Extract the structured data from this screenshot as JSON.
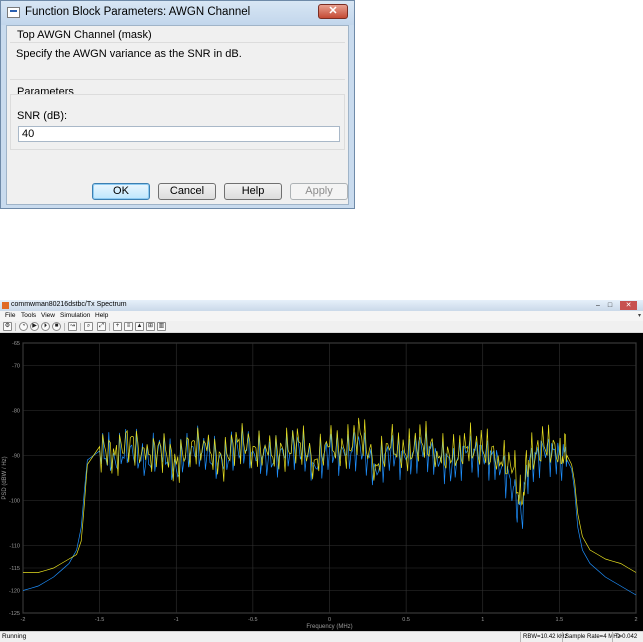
{
  "dialog": {
    "title": "Function Block Parameters: AWGN Channel",
    "close_label": "✕",
    "app_icon": "simulink-block-icon",
    "mask_header": "Top AWGN Channel (mask)",
    "description": "Specify the AWGN variance as the SNR in dB.",
    "params_header": "Parameters",
    "snr_label": "SNR (dB):",
    "snr_value": "40",
    "buttons": {
      "ok": "OK",
      "cancel": "Cancel",
      "help": "Help",
      "apply": "Apply"
    }
  },
  "scope": {
    "title": "commwman80216dstbc/Tx Spectrum",
    "app_icon": "matlab-icon",
    "window_buttons": {
      "minimize": "–",
      "maximize": "□",
      "close": "✕"
    },
    "menu": [
      "File",
      "Tools",
      "View",
      "Simulation",
      "Help"
    ],
    "menu_arrow": "▾",
    "toolbar_icons": [
      "scope-settings-icon",
      "run-icon",
      "play-icon",
      "step-icon",
      "stop-icon",
      "highlight-icon",
      "zoom-icon",
      "autoscale-icon",
      "data-cursor-icon",
      "measurements-icon",
      "peak-finder-icon",
      "cursor-measurements-icon",
      "channel-measurements-icon"
    ],
    "status": {
      "state": "Running",
      "rbw": "RBW=10.42 kHz",
      "sample_rate": "Sample Rate=4 MHz",
      "time": "T=0.042"
    }
  },
  "chart_data": {
    "type": "line",
    "title": "",
    "xlabel": "Frequency (MHz)",
    "ylabel": "PSD (dBW / Hz)",
    "xlim": [
      -2,
      2
    ],
    "ylim": [
      -125,
      -65
    ],
    "xticks": [
      "-2",
      "-1.5",
      "-1",
      "-0.5",
      "0",
      "0.5",
      "1",
      "1.5",
      "2"
    ],
    "yticks": [
      "-65",
      "-70",
      "-80",
      "-90",
      "-100",
      "-110",
      "-115",
      "-120",
      "-125"
    ],
    "grid": true,
    "background": "#000000",
    "series": [
      {
        "color": "#1e90ff",
        "x": [
          -2,
          -1.9,
          -1.8,
          -1.7,
          -1.65,
          -1.62,
          -1.6,
          -1.58,
          -1.5,
          -1.4,
          -1.3,
          -1.2,
          -1.1,
          -1.0,
          -0.9,
          -0.8,
          -0.7,
          -0.6,
          -0.5,
          -0.4,
          -0.3,
          -0.2,
          -0.1,
          0,
          0.1,
          0.2,
          0.3,
          0.4,
          0.5,
          0.6,
          0.7,
          0.8,
          0.9,
          1.0,
          1.1,
          1.2,
          1.25,
          1.3,
          1.4,
          1.5,
          1.55,
          1.58,
          1.6,
          1.62,
          1.65,
          1.7,
          1.8,
          1.9,
          2
        ],
        "values": [
          -120,
          -119,
          -117,
          -114,
          -111,
          -106,
          -98,
          -91,
          -89,
          -91,
          -88,
          -92,
          -89,
          -93,
          -88,
          -90,
          -92,
          -88,
          -89,
          -91,
          -90,
          -88,
          -92,
          -89,
          -90,
          -88,
          -93,
          -89,
          -91,
          -88,
          -90,
          -92,
          -89,
          -90,
          -91,
          -97,
          -103,
          -92,
          -89,
          -90,
          -91,
          -93,
          -98,
          -106,
          -111,
          -114,
          -117,
          -119,
          -121
        ]
      },
      {
        "color": "#e8e020",
        "x": [
          -2,
          -1.9,
          -1.8,
          -1.7,
          -1.65,
          -1.62,
          -1.6,
          -1.58,
          -1.5,
          -1.4,
          -1.3,
          -1.2,
          -1.1,
          -1.0,
          -0.9,
          -0.8,
          -0.7,
          -0.6,
          -0.5,
          -0.4,
          -0.3,
          -0.2,
          -0.1,
          0,
          0.1,
          0.2,
          0.3,
          0.4,
          0.5,
          0.6,
          0.7,
          0.8,
          0.9,
          1.0,
          1.1,
          1.2,
          1.25,
          1.3,
          1.4,
          1.5,
          1.55,
          1.58,
          1.6,
          1.62,
          1.65,
          1.7,
          1.8,
          1.9,
          2
        ],
        "values": [
          -116,
          -116,
          -115,
          -113,
          -112,
          -109,
          -101,
          -92,
          -88,
          -90,
          -86,
          -91,
          -88,
          -92,
          -87,
          -89,
          -91,
          -87,
          -88,
          -90,
          -89,
          -87,
          -91,
          -88,
          -89,
          -85,
          -92,
          -88,
          -90,
          -87,
          -89,
          -91,
          -88,
          -89,
          -90,
          -93,
          -100,
          -91,
          -88,
          -89,
          -90,
          -92,
          -96,
          -103,
          -108,
          -111,
          -113,
          -114,
          -116
        ]
      }
    ]
  }
}
